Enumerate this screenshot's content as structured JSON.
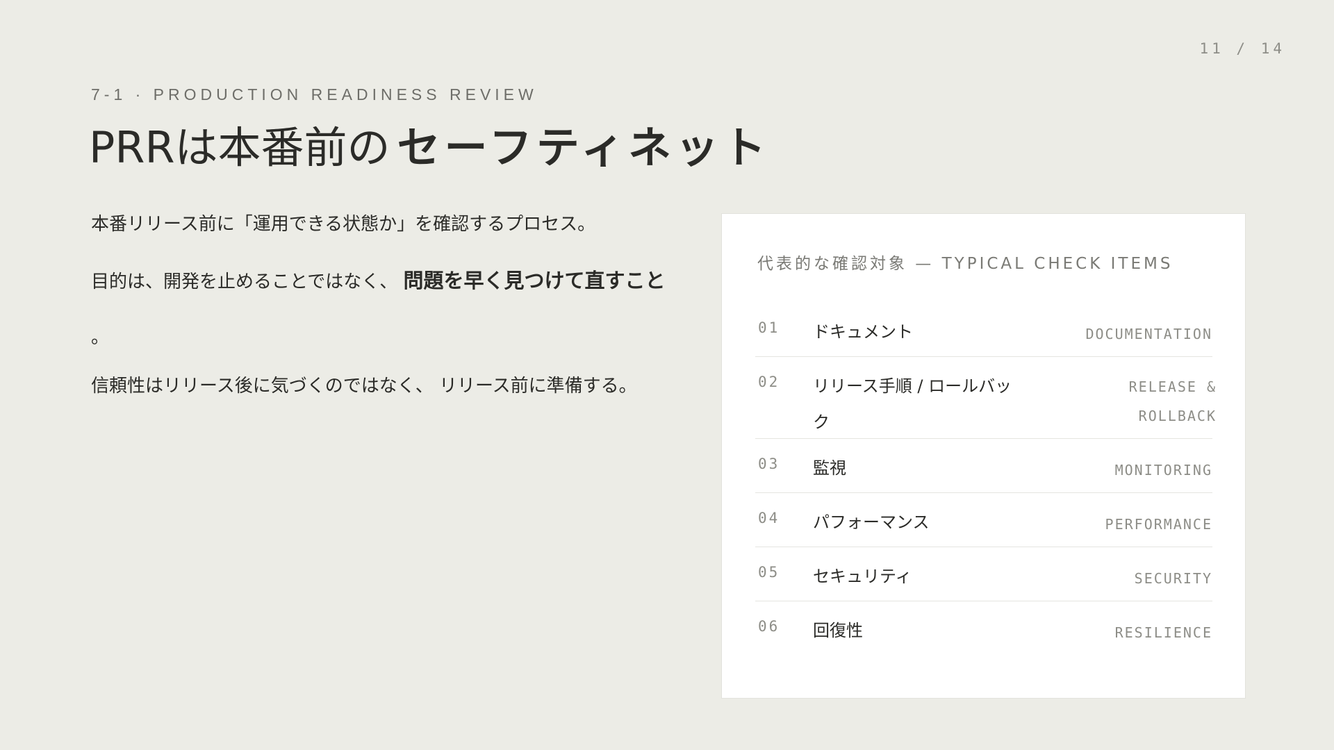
{
  "page": {
    "number": "11 / 14"
  },
  "eyebrow": "7-1 · PRODUCTION READINESS REVIEW",
  "title": {
    "regular": "PRRは本番前の",
    "bold": "セーフティネット"
  },
  "body": {
    "p1": "本番リリース前に「運用できる状態か」を確認するプロセス。",
    "p2_prefix": "目的は、開発を止めることではなく、",
    "p2_bold": "問題を早く見つけて直すこと",
    "p2_suffix": "。",
    "p3": "信頼性はリリース後に気づくのではなく、 リリース前に準備する。"
  },
  "card": {
    "title": "代表的な確認対象 — TYPICAL CHECK ITEMS",
    "items": [
      {
        "num": "01",
        "jp": "ドキュメント",
        "en": "DOCUMENTATION"
      },
      {
        "num": "02",
        "jp": "リリース手順 / ロールバック",
        "en": "RELEASE & ROLLBACK"
      },
      {
        "num": "03",
        "jp": "監視",
        "en": "MONITORING"
      },
      {
        "num": "04",
        "jp": "パフォーマンス",
        "en": "PERFORMANCE"
      },
      {
        "num": "05",
        "jp": "セキュリティ",
        "en": "SECURITY"
      },
      {
        "num": "06",
        "jp": "回復性",
        "en": "RESILIENCE"
      }
    ]
  }
}
